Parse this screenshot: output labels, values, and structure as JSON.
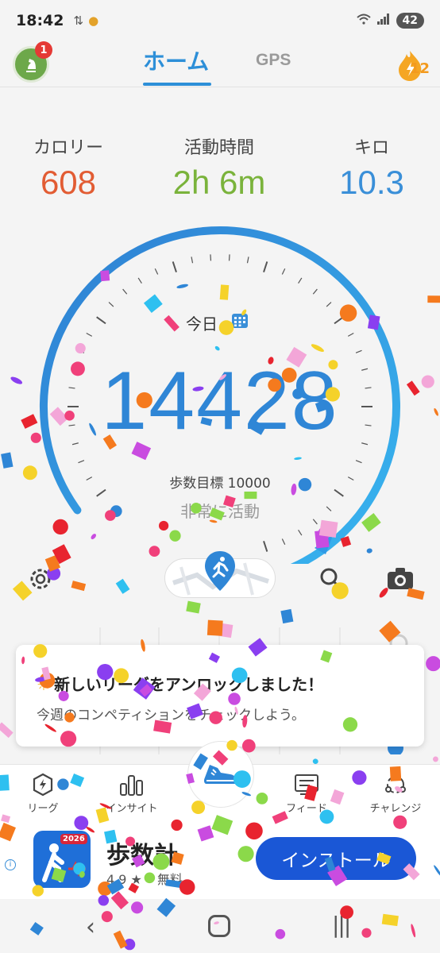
{
  "status_bar": {
    "time": "18:42",
    "battery": "42"
  },
  "header": {
    "tab_home": "ホーム",
    "tab_gps": "GPS",
    "avatar_badge": "1",
    "streak_count": "12"
  },
  "stats": [
    {
      "label": "カロリー",
      "value": "608",
      "color": "#e25c33"
    },
    {
      "label": "活動時間",
      "value": "2h 6m",
      "color": "#7ab33b"
    },
    {
      "label": "キロ",
      "value": "10.3",
      "color": "#3a8fd8"
    }
  ],
  "gauge": {
    "today_label": "今日",
    "steps": "14428",
    "goal_text": "歩数目標 10000",
    "activity_level": "非常に活動",
    "progress_fraction": 1.0
  },
  "toast": {
    "title": "新しいリーグをアンロックしました！",
    "subtitle": "今週のコンペティションをチェックしよう。"
  },
  "bottom_nav": {
    "league": "リーグ",
    "insight": "インサイト",
    "feed": "フィード",
    "challenge": "チャレンジ"
  },
  "ad": {
    "app_name": "歩数計",
    "badge": "2026",
    "rating": "4.9 ★",
    "price": "無料",
    "install": "インストール"
  },
  "colors": {
    "accent": "#2d8fd8",
    "install": "#1a57d6"
  }
}
